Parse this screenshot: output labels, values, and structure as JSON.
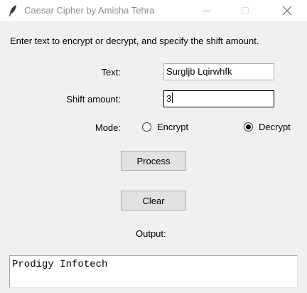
{
  "window": {
    "title": "Caesar Cipher by Amisha Tehra"
  },
  "instructions": "Enter text to encrypt or decrypt, and specify the shift amount.",
  "form": {
    "text_label": "Text:",
    "text_value": "Surgljb Lqirwhfk",
    "shift_label": "Shift amount:",
    "shift_value": "3",
    "mode_label": "Mode:",
    "mode_options": [
      {
        "label": "Encrypt",
        "selected": false
      },
      {
        "label": "Decrypt",
        "selected": true
      }
    ]
  },
  "buttons": {
    "process_label": "Process",
    "clear_label": "Clear"
  },
  "output": {
    "label": "Output:",
    "value": "Prodigy Infotech"
  },
  "icons": {
    "app": "feather-icon",
    "minimize": "minimize-icon",
    "maximize": "maximize-icon",
    "close": "close-icon"
  }
}
